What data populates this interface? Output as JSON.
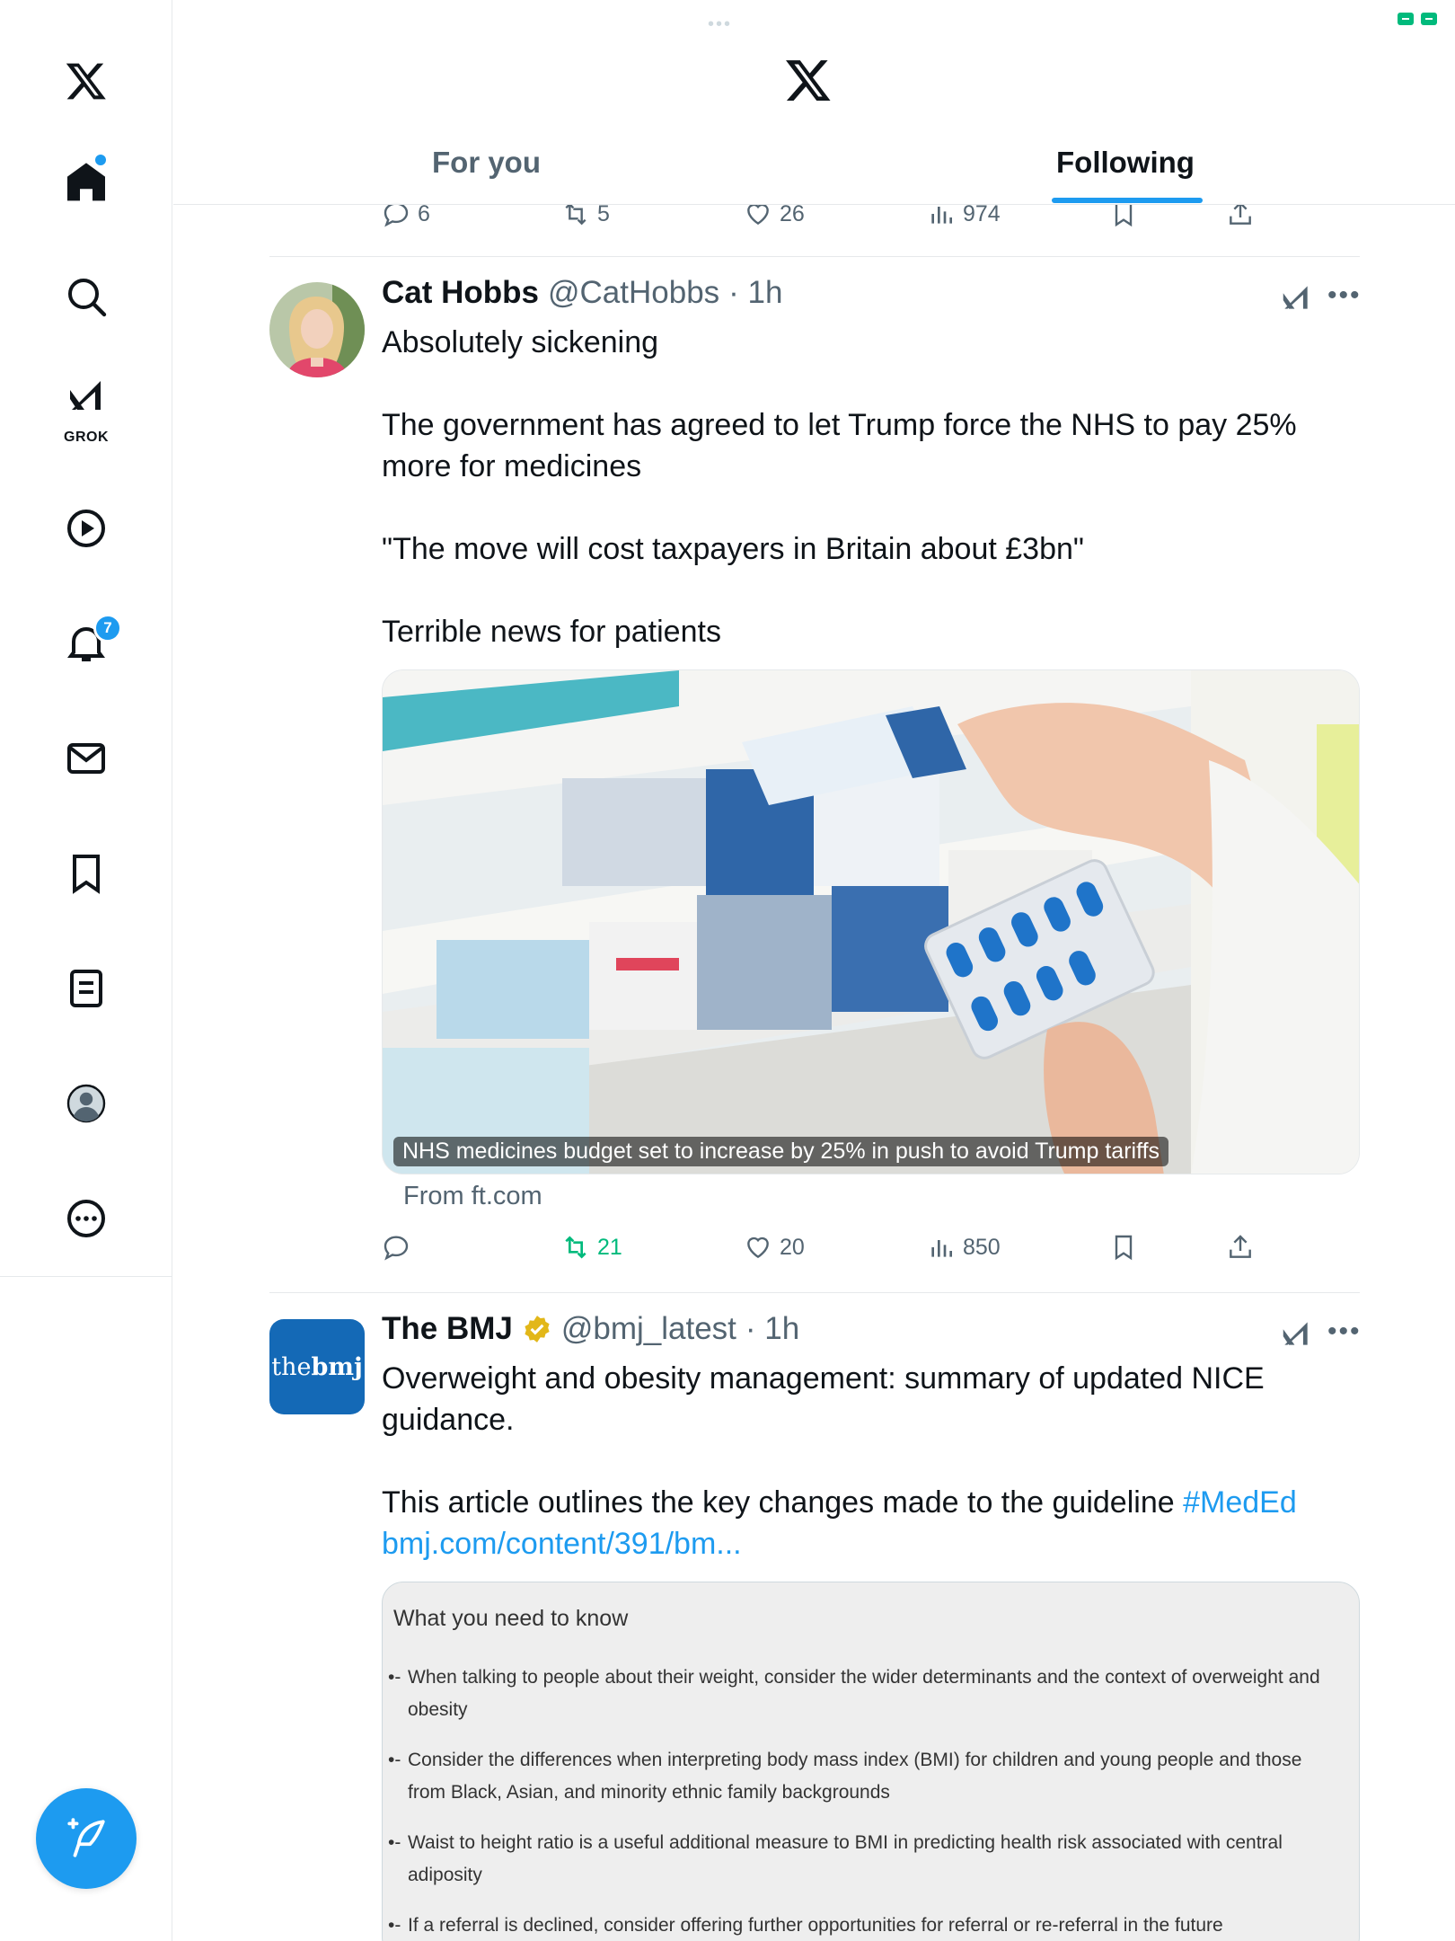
{
  "header": {
    "tabs": [
      {
        "label": "For you",
        "active": false
      },
      {
        "label": "Following",
        "active": true
      }
    ]
  },
  "sidebar": {
    "grok_label": "GROK",
    "notification_count": "7",
    "items": [
      "home-icon",
      "search-icon",
      "grok-icon",
      "video-icon",
      "bell-icon",
      "mail-icon",
      "bookmark-icon",
      "list-icon",
      "profile-icon",
      "more-icon"
    ]
  },
  "prev_tweet": {
    "replies": "6",
    "reposts": "5",
    "likes": "26",
    "views": "974"
  },
  "tweets": [
    {
      "display_name": "Cat Hobbs",
      "handle": "@CatHobbs",
      "time": "· 1h",
      "lines": [
        "Absolutely sickening",
        "",
        "The government has agreed to let Trump force the NHS to pay 25% more for medicines",
        "",
        "\"The move will cost taxpayers in Britain about £3bn\"",
        "",
        "Terrible news for patients"
      ],
      "media_caption": "NHS medicines budget set to increase by 25% in push to avoid Trump tariffs",
      "from": "From ft.com",
      "replies": "",
      "reposts": "21",
      "likes": "20",
      "views": "850"
    },
    {
      "display_name": "The BMJ",
      "handle": "@bmj_latest",
      "time": "· 1h",
      "avatar_text_a": "the",
      "avatar_text_b": "bmj",
      "line1": "Overweight and obesity management: summary of updated NICE guidance.",
      "line2_text": "This article outlines the key changes made to the guideline ",
      "hashtag": "#MedEd",
      "link": "bmj.com/content/391/bm...",
      "card_title": "What you need to know",
      "card_items": [
        "When talking to people about their weight, consider the wider determinants and the context of overweight and obesity",
        "Consider the differences when interpreting body mass index (BMI) for children and young people and those from Black, Asian, and minority ethnic family backgrounds",
        "Waist to height ratio is a useful additional measure to BMI in predicting health risk associated with central adiposity",
        "If a referral is declined, consider offering further opportunities for referral or re-referral in the future"
      ]
    }
  ],
  "colors": {
    "accent": "#1d9bf0",
    "repost_active": "#00ba7c",
    "secondary_text": "#536471",
    "bmj_blue": "#1469b6"
  }
}
